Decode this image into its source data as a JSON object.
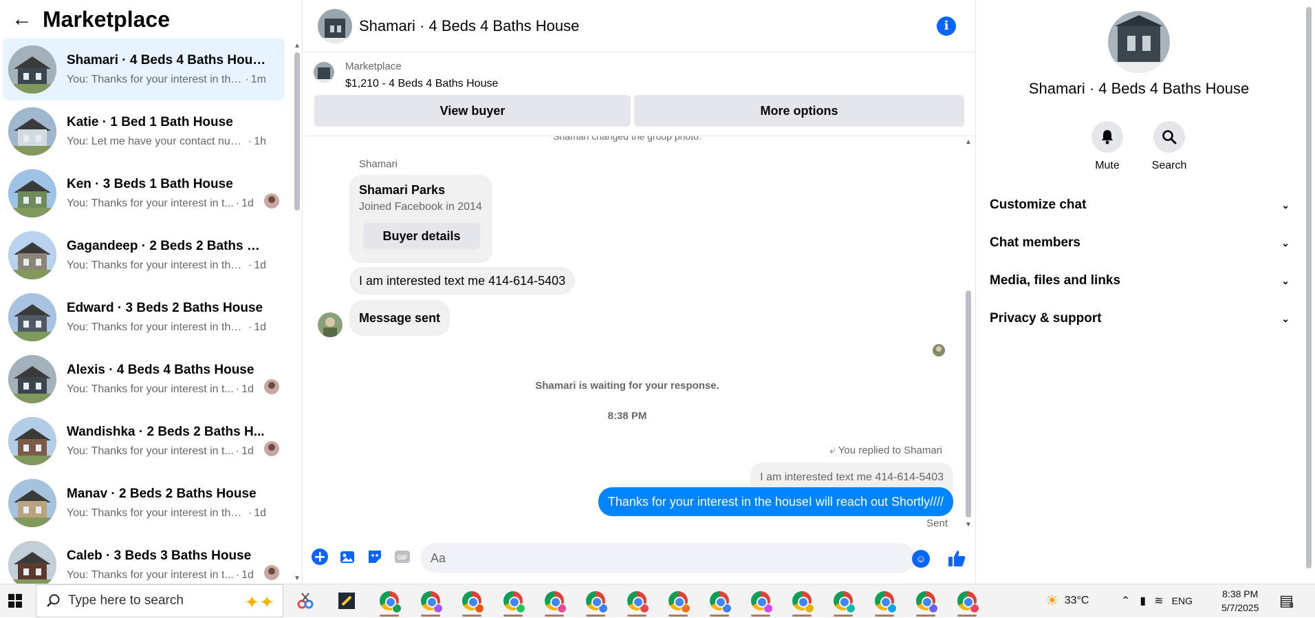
{
  "left": {
    "title": "Marketplace",
    "conversations": [
      {
        "title": "Shamari · 4 Beds 4 Baths House",
        "preview": "You: Thanks for your interest in the...",
        "time": "1m",
        "active": true,
        "seen": false
      },
      {
        "title": "Katie · 1 Bed 1 Bath House",
        "preview": "You: Let me have your contact num...",
        "time": "1h",
        "active": false,
        "seen": false
      },
      {
        "title": "Ken · 3 Beds 1 Bath House",
        "preview": "You: Thanks for your interest in t...",
        "time": "1d",
        "active": false,
        "seen": true
      },
      {
        "title": "Gagandeep · 2 Beds 2 Baths Ho...",
        "preview": "You: Thanks for your interest in the ...",
        "time": "1d",
        "active": false,
        "seen": false
      },
      {
        "title": "Edward · 3 Beds 2 Baths House",
        "preview": "You: Thanks for your interest in the ...",
        "time": "1d",
        "active": false,
        "seen": false
      },
      {
        "title": "Alexis · 4 Beds 4 Baths House",
        "preview": "You: Thanks for your interest in t...",
        "time": "1d",
        "active": false,
        "seen": true
      },
      {
        "title": "Wandishka · 2 Beds 2 Baths H...",
        "preview": "You: Thanks for your interest in t...",
        "time": "1d",
        "active": false,
        "seen": true
      },
      {
        "title": "Manav · 2 Beds 2 Baths House",
        "preview": "You: Thanks for your interest in the ...",
        "time": "1d",
        "active": false,
        "seen": false
      },
      {
        "title": "Caleb · 3 Beds 3 Baths House",
        "preview": "You: Thanks for your interest in t...",
        "time": "1d",
        "active": false,
        "seen": true
      }
    ]
  },
  "chat": {
    "header_title": "Shamari · 4 Beds 4 Baths House",
    "marketplace_label": "Marketplace",
    "listing": "$1,210 - 4 Beds 4 Baths House",
    "view_buyer": "View buyer",
    "more_options": "More options",
    "system_top": "Shamari changed the group photo.",
    "sender_name": "Shamari",
    "card_name": "Shamari Parks",
    "card_joined": "Joined Facebook in 2014",
    "card_button": "Buyer details",
    "msg_interest": "I am interested text me 414-614-5403",
    "msg_sent": "Message sent",
    "waiting": "Shamari is waiting for your response.",
    "timestamp": "8:38 PM",
    "replied_to": "You replied to Shamari",
    "quoted": "I am interested text me 414-614-5403",
    "outgoing": "Thanks for your interest in the houseI will reach out Shortly////",
    "status": "Sent",
    "composer_placeholder": "Aa",
    "gif_label": "GIF"
  },
  "right": {
    "title": "Shamari · 4 Beds 4 Baths House",
    "mute": "Mute",
    "search": "Search",
    "sections": [
      "Customize chat",
      "Chat members",
      "Media, files and links",
      "Privacy & support"
    ]
  },
  "taskbar": {
    "search_placeholder": "Type here to search",
    "weather": "33°C",
    "language": "ENG",
    "time": "8:38 PM",
    "date": "5/7/2025",
    "notifications": "8"
  },
  "colors": {
    "accent": "#0866ff",
    "outgoing_bubble": "#0084ff",
    "active_row": "#e7f3ff"
  }
}
